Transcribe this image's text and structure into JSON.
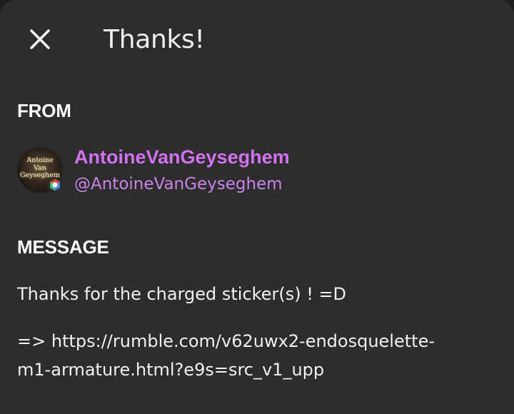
{
  "header": {
    "close_icon": "close-icon",
    "title": "Thanks!"
  },
  "from": {
    "label": "FROM",
    "avatar_text": "Antoine\nVan\nGeyseghem",
    "badge_icon": "hexagon-badge-icon",
    "display_name": "AntoineVanGeyseghem",
    "handle": "@AntoineVanGeyseghem"
  },
  "message": {
    "label": "MESSAGE",
    "line1": "Thanks for the charged sticker(s) ! =D",
    "link_prefix": "=> ",
    "link_part1": "https://rumble.com/v62uwx2-endosquelette-",
    "link_part2": "m1-armature.html?e9s=src_v1_upp"
  },
  "colors": {
    "background": "#2c2d2c",
    "text": "#f2f2f2",
    "accent_name": "#cf73ef",
    "accent_handle": "#c985e6"
  }
}
